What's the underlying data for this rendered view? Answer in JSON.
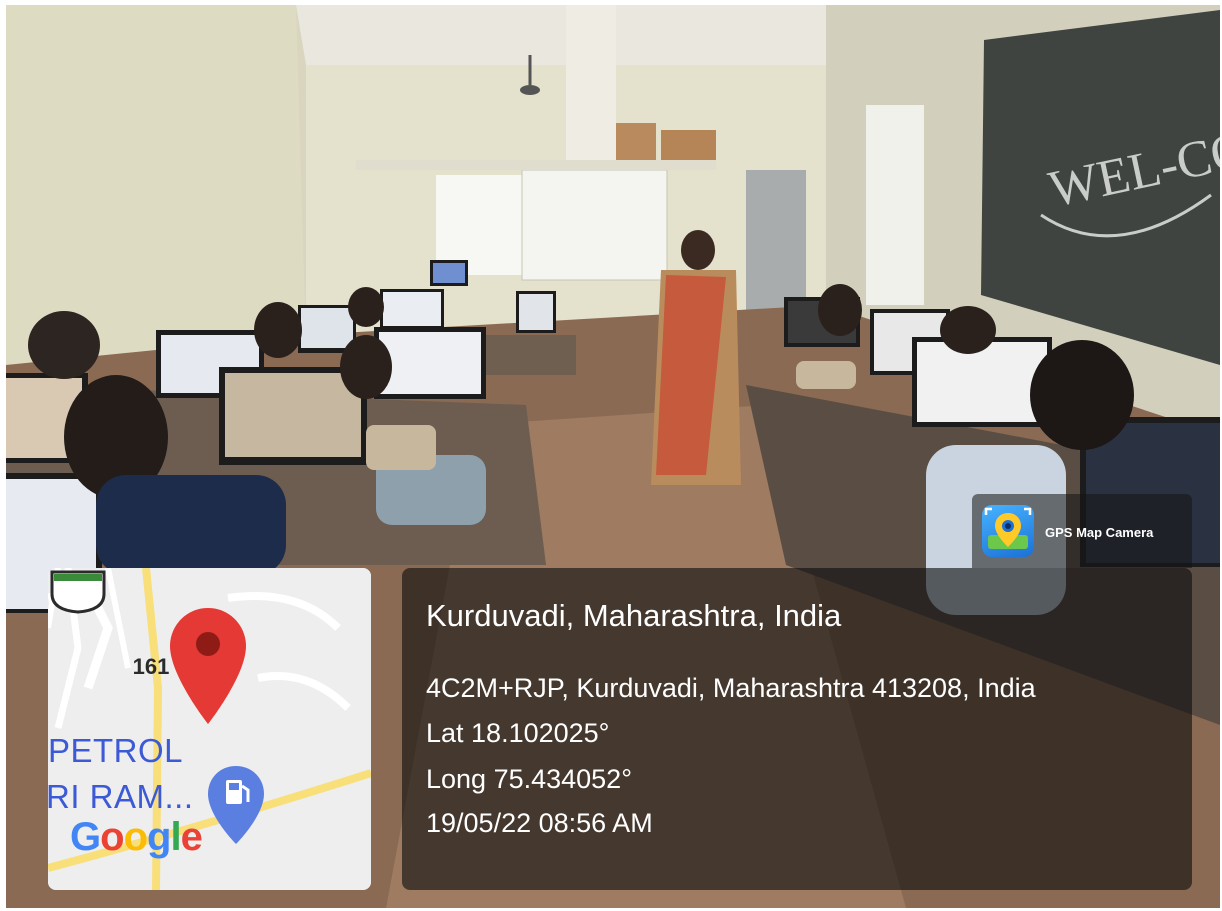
{
  "map": {
    "route_shield": "161",
    "poi_line_1": "PETROL",
    "poi_line_2": "RI RAM...",
    "logo": [
      "G",
      "o",
      "o",
      "g",
      "l",
      "e"
    ],
    "logo_colors": [
      "#4285F4",
      "#EA4335",
      "#FBBC05",
      "#4285F4",
      "#34A853",
      "#EA4335"
    ],
    "pin_color": "#E53935",
    "fuel_icon": "fuel-pump-icon"
  },
  "location": {
    "title": "Kurduvadi, Maharashtra, India",
    "address": "4C2M+RJP, Kurduvadi, Maharashtra 413208, India",
    "latitude": "Lat 18.102025°",
    "longitude": "Long 75.434052°",
    "timestamp": "19/05/22 08:56 AM"
  },
  "badge": {
    "app_name": "GPS Map Camera",
    "icon": "gps-map-camera-app-icon"
  },
  "scene": {
    "board_text": "WEL-COME"
  }
}
